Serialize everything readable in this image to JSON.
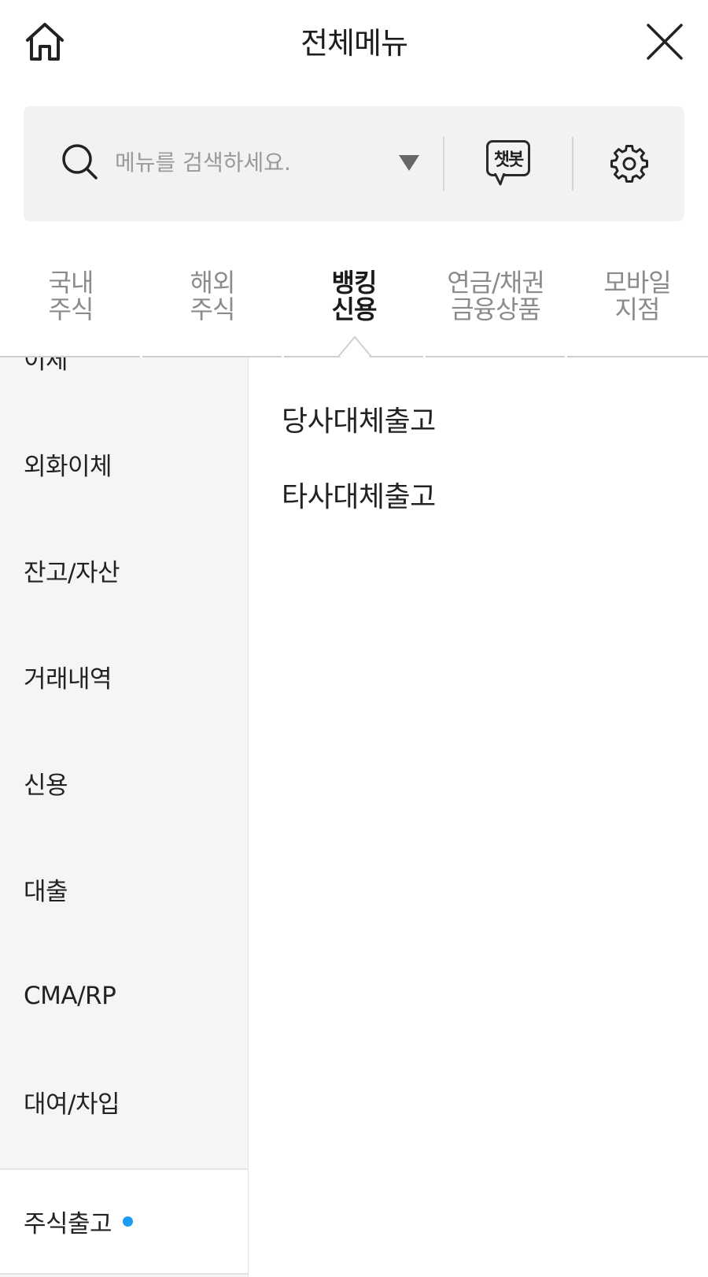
{
  "header": {
    "title": "전체메뉴",
    "home_icon": "home-icon",
    "close_icon": "close-icon"
  },
  "search": {
    "placeholder": "메뉴를 검색하세요.",
    "value": "",
    "chatbot_label": "챗봇",
    "settings_icon": "gear-icon"
  },
  "tabs": [
    {
      "line1": "국내",
      "line2": "주식",
      "active": false
    },
    {
      "line1": "해외",
      "line2": "주식",
      "active": false
    },
    {
      "line1": "뱅킹",
      "line2": "신용",
      "active": true
    },
    {
      "line1": "연금/채권",
      "line2": "금융상품",
      "active": false
    },
    {
      "line1": "모바일",
      "line2": "지점",
      "active": false
    }
  ],
  "left_menu": {
    "items": [
      {
        "label": "이체"
      },
      {
        "label": "외화이체"
      },
      {
        "label": "잔고/자산"
      },
      {
        "label": "거래내역"
      },
      {
        "label": "신용"
      },
      {
        "label": "대출"
      },
      {
        "label": "CMA/RP"
      },
      {
        "label": "대여/차입"
      },
      {
        "label": "주식출고",
        "selected": true,
        "has_new_dot": true
      }
    ]
  },
  "sub_menu": {
    "items": [
      {
        "label": "당사대체출고"
      },
      {
        "label": "타사대체출고"
      }
    ]
  },
  "colors": {
    "accent_dot": "#1a9cf0",
    "search_bg": "#f2f2f2",
    "left_panel_bg": "#f5f5f5",
    "inactive_tab": "#8b8b8b"
  }
}
